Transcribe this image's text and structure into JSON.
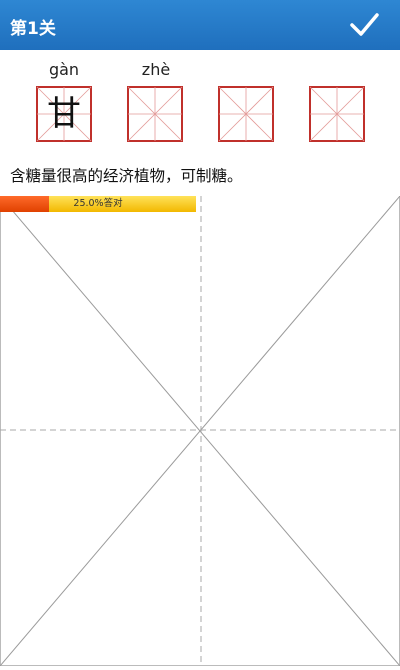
{
  "header": {
    "title": "第1关",
    "confirm_icon": "checkmark-icon",
    "background": "#2a7fd0"
  },
  "characters": [
    {
      "pinyin": "gàn",
      "char": "甘"
    },
    {
      "pinyin": "zhè",
      "char": ""
    },
    {
      "pinyin": "",
      "char": ""
    },
    {
      "pinyin": "",
      "char": ""
    }
  ],
  "sentence": "含糖量很高的经济植物，可制糖。",
  "progress": {
    "label": "25.0%答对",
    "value": 0.25
  },
  "colors": {
    "grid_border": "#c0302b",
    "grid_guides": "#e39a98",
    "progress_fill": "#ff5a1f",
    "progress_track": "#f5c400"
  }
}
